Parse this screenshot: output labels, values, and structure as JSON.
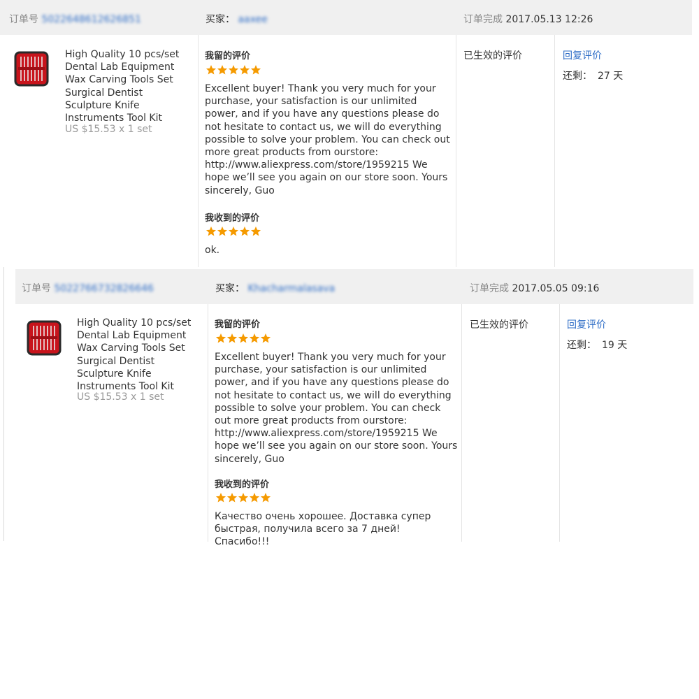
{
  "star_color": "#f59a00",
  "link_color": "#2d6cc6",
  "orders": [
    {
      "order_label": "订单号",
      "order_no": "5022648612626851",
      "buyer_label": "买家：",
      "buyer": "aaxee",
      "status_label": "订单完成",
      "completed_time": "2017.05.13 12:26",
      "product_name": "High Quality 10 pcs/set Dental Lab Equipment Wax Carving Tools Set Surgical Dentist Sculpture Knife Instruments Tool Kit",
      "price": "US $15.53 x 1 set",
      "my_review_title": "我留的评价",
      "my_review_stars": 5,
      "my_review_text": "Excellent buyer! Thank you very much for your purchase, your satisfaction is our unlimited power, and if you have any questions please do not hesitate to contact us, we will do everything possible to solve your problem. You can check out more great products from ourstore: http://www.aliexpress.com/store/1959215 We hope we’ll see you again on our store soon. Yours sincerely, Guo",
      "received_review_title": "我收到的评价",
      "received_review_stars": 5,
      "received_review_text": "ok.",
      "effective_label": "已生效的评价",
      "reply_label": "回复评价",
      "remaining_label": "还剩：",
      "remaining_value": "27 天"
    },
    {
      "order_label": "订单号",
      "order_no": "5022766732826646",
      "buyer_label": "买家：",
      "buyer": "Khacharmalasava",
      "status_label": "订单完成",
      "completed_time": "2017.05.05 09:16",
      "product_name": "High Quality 10 pcs/set Dental Lab Equipment Wax Carving Tools Set Surgical Dentist Sculpture Knife Instruments Tool Kit",
      "price": "US $15.53 x 1 set",
      "my_review_title": "我留的评价",
      "my_review_stars": 5,
      "my_review_text": "Excellent buyer! Thank you very much for your purchase, your satisfaction is our unlimited power, and if you have any questions please do not hesitate to contact us, we will do everything possible to solve your problem. You can check out more great products from ourstore: http://www.aliexpress.com/store/1959215 We hope we’ll see you again on our store soon. Yours sincerely, Guo",
      "received_review_title": "我收到的评价",
      "received_review_stars": 5,
      "received_review_text": "Качество очень хорошее. Доставка супер быстрая, получила всего за 7 дней! Спасибо!!!",
      "effective_label": "已生效的评价",
      "reply_label": "回复评价",
      "remaining_label": "还剩：",
      "remaining_value": "19 天"
    }
  ]
}
